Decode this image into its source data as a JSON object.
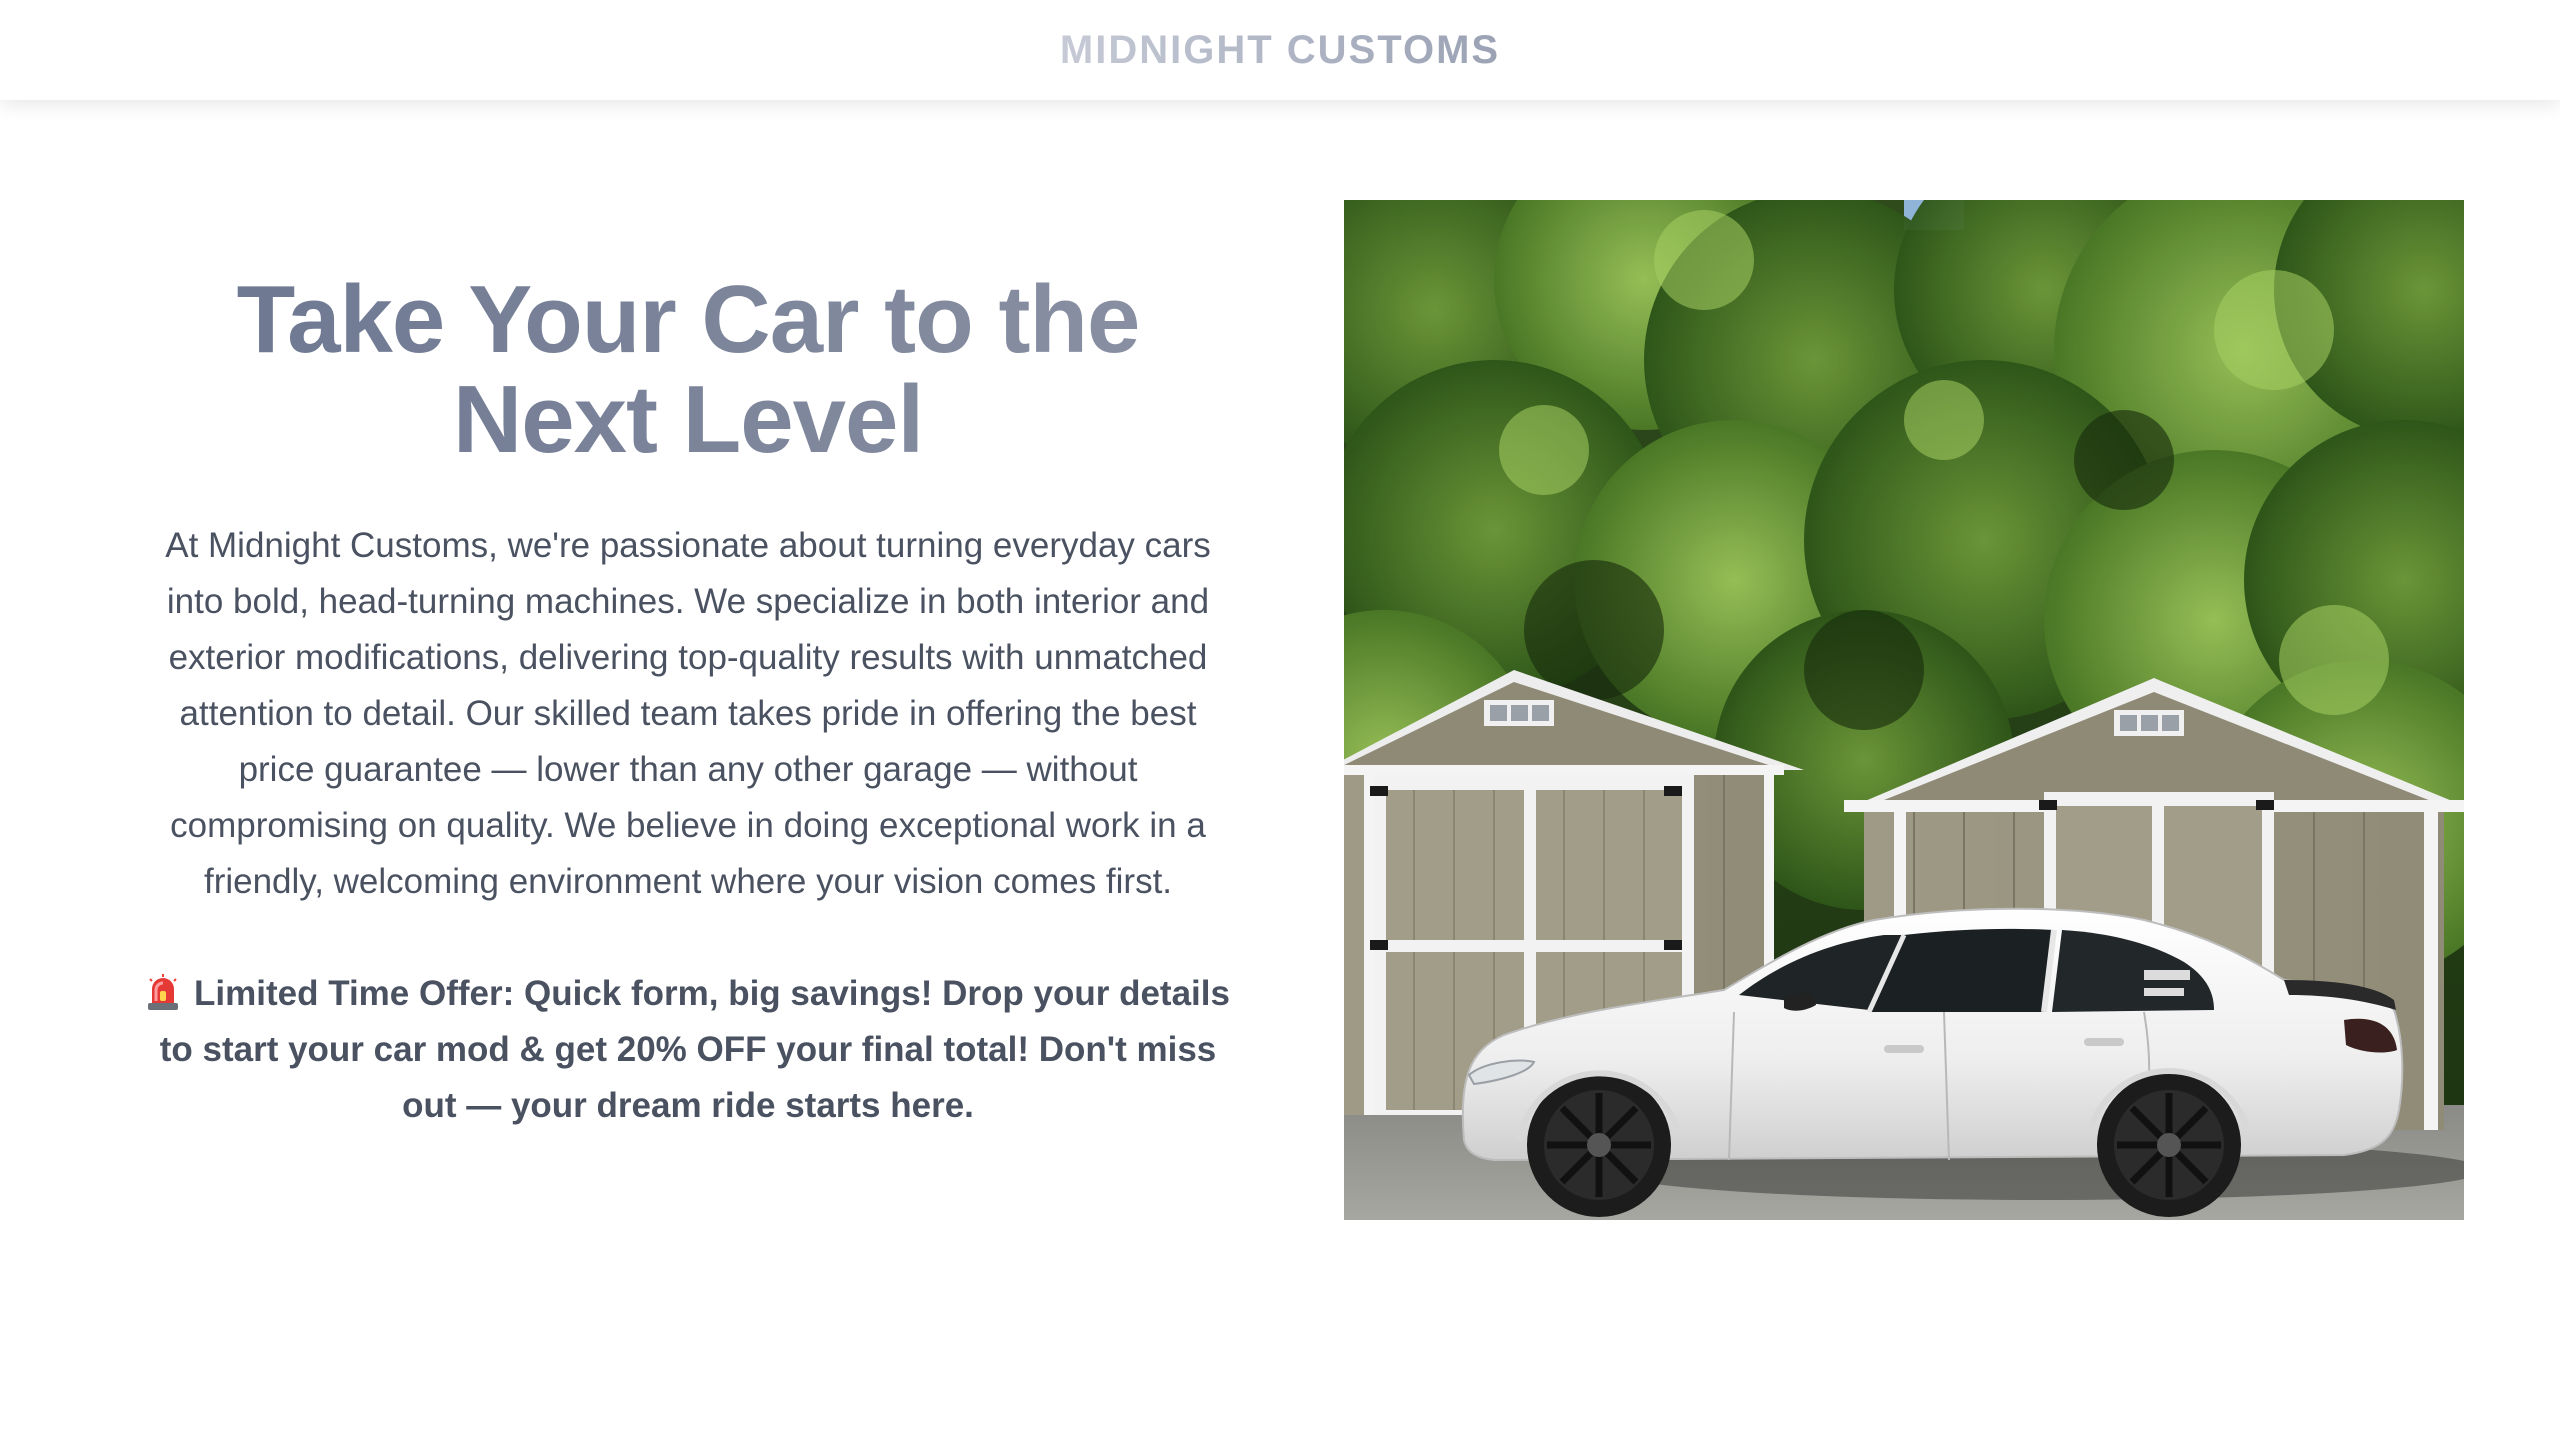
{
  "header": {
    "brand": "MIDNIGHT CUSTOMS"
  },
  "hero": {
    "headline_line1": "Take Your Car to the",
    "headline_line2": "Next Level",
    "description": "At Midnight Customs, we're passionate about turning everyday cars into bold, head-turning machines. We specialize in both interior and exterior modifications, delivering top-quality results with unmatched attention to detail. Our skilled team takes pride in offering the best price guarantee — lower than any other garage — without compromising on quality. We believe in doing exceptional work in a friendly, welcoming environment where your vision comes first.",
    "offer_icon": "siren-icon",
    "offer": "Limited Time Offer: Quick form, big savings! Drop your details to start your car mod & get 20% OFF your final total! Don't miss out — your dream ride starts here."
  },
  "image": {
    "description_icon": "car-photo"
  },
  "colors": {
    "brand_gradient_start": "#c6cad6",
    "brand_gradient_end": "#9aa2b4",
    "headline": "#6b7690",
    "body_text": "#4a5261"
  }
}
